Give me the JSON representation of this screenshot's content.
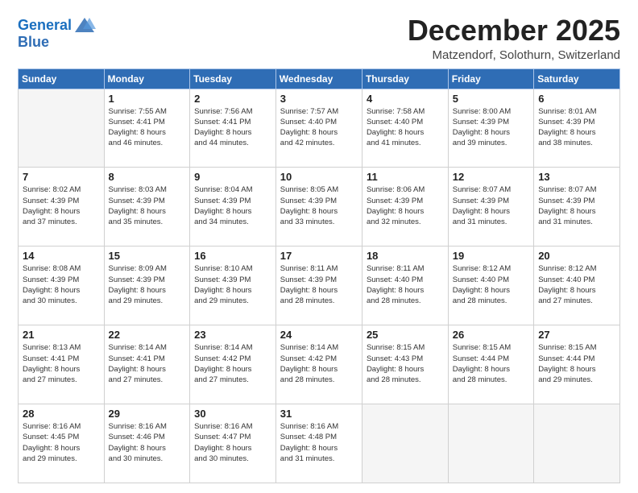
{
  "logo": {
    "line1": "General",
    "line2": "Blue"
  },
  "title": "December 2025",
  "location": "Matzendorf, Solothurn, Switzerland",
  "headers": [
    "Sunday",
    "Monday",
    "Tuesday",
    "Wednesday",
    "Thursday",
    "Friday",
    "Saturday"
  ],
  "weeks": [
    [
      {
        "day": "",
        "info": ""
      },
      {
        "day": "1",
        "info": "Sunrise: 7:55 AM\nSunset: 4:41 PM\nDaylight: 8 hours\nand 46 minutes."
      },
      {
        "day": "2",
        "info": "Sunrise: 7:56 AM\nSunset: 4:41 PM\nDaylight: 8 hours\nand 44 minutes."
      },
      {
        "day": "3",
        "info": "Sunrise: 7:57 AM\nSunset: 4:40 PM\nDaylight: 8 hours\nand 42 minutes."
      },
      {
        "day": "4",
        "info": "Sunrise: 7:58 AM\nSunset: 4:40 PM\nDaylight: 8 hours\nand 41 minutes."
      },
      {
        "day": "5",
        "info": "Sunrise: 8:00 AM\nSunset: 4:39 PM\nDaylight: 8 hours\nand 39 minutes."
      },
      {
        "day": "6",
        "info": "Sunrise: 8:01 AM\nSunset: 4:39 PM\nDaylight: 8 hours\nand 38 minutes."
      }
    ],
    [
      {
        "day": "7",
        "info": "Sunrise: 8:02 AM\nSunset: 4:39 PM\nDaylight: 8 hours\nand 37 minutes."
      },
      {
        "day": "8",
        "info": "Sunrise: 8:03 AM\nSunset: 4:39 PM\nDaylight: 8 hours\nand 35 minutes."
      },
      {
        "day": "9",
        "info": "Sunrise: 8:04 AM\nSunset: 4:39 PM\nDaylight: 8 hours\nand 34 minutes."
      },
      {
        "day": "10",
        "info": "Sunrise: 8:05 AM\nSunset: 4:39 PM\nDaylight: 8 hours\nand 33 minutes."
      },
      {
        "day": "11",
        "info": "Sunrise: 8:06 AM\nSunset: 4:39 PM\nDaylight: 8 hours\nand 32 minutes."
      },
      {
        "day": "12",
        "info": "Sunrise: 8:07 AM\nSunset: 4:39 PM\nDaylight: 8 hours\nand 31 minutes."
      },
      {
        "day": "13",
        "info": "Sunrise: 8:07 AM\nSunset: 4:39 PM\nDaylight: 8 hours\nand 31 minutes."
      }
    ],
    [
      {
        "day": "14",
        "info": "Sunrise: 8:08 AM\nSunset: 4:39 PM\nDaylight: 8 hours\nand 30 minutes."
      },
      {
        "day": "15",
        "info": "Sunrise: 8:09 AM\nSunset: 4:39 PM\nDaylight: 8 hours\nand 29 minutes."
      },
      {
        "day": "16",
        "info": "Sunrise: 8:10 AM\nSunset: 4:39 PM\nDaylight: 8 hours\nand 29 minutes."
      },
      {
        "day": "17",
        "info": "Sunrise: 8:11 AM\nSunset: 4:39 PM\nDaylight: 8 hours\nand 28 minutes."
      },
      {
        "day": "18",
        "info": "Sunrise: 8:11 AM\nSunset: 4:40 PM\nDaylight: 8 hours\nand 28 minutes."
      },
      {
        "day": "19",
        "info": "Sunrise: 8:12 AM\nSunset: 4:40 PM\nDaylight: 8 hours\nand 28 minutes."
      },
      {
        "day": "20",
        "info": "Sunrise: 8:12 AM\nSunset: 4:40 PM\nDaylight: 8 hours\nand 27 minutes."
      }
    ],
    [
      {
        "day": "21",
        "info": "Sunrise: 8:13 AM\nSunset: 4:41 PM\nDaylight: 8 hours\nand 27 minutes."
      },
      {
        "day": "22",
        "info": "Sunrise: 8:14 AM\nSunset: 4:41 PM\nDaylight: 8 hours\nand 27 minutes."
      },
      {
        "day": "23",
        "info": "Sunrise: 8:14 AM\nSunset: 4:42 PM\nDaylight: 8 hours\nand 27 minutes."
      },
      {
        "day": "24",
        "info": "Sunrise: 8:14 AM\nSunset: 4:42 PM\nDaylight: 8 hours\nand 28 minutes."
      },
      {
        "day": "25",
        "info": "Sunrise: 8:15 AM\nSunset: 4:43 PM\nDaylight: 8 hours\nand 28 minutes."
      },
      {
        "day": "26",
        "info": "Sunrise: 8:15 AM\nSunset: 4:44 PM\nDaylight: 8 hours\nand 28 minutes."
      },
      {
        "day": "27",
        "info": "Sunrise: 8:15 AM\nSunset: 4:44 PM\nDaylight: 8 hours\nand 29 minutes."
      }
    ],
    [
      {
        "day": "28",
        "info": "Sunrise: 8:16 AM\nSunset: 4:45 PM\nDaylight: 8 hours\nand 29 minutes."
      },
      {
        "day": "29",
        "info": "Sunrise: 8:16 AM\nSunset: 4:46 PM\nDaylight: 8 hours\nand 30 minutes."
      },
      {
        "day": "30",
        "info": "Sunrise: 8:16 AM\nSunset: 4:47 PM\nDaylight: 8 hours\nand 30 minutes."
      },
      {
        "day": "31",
        "info": "Sunrise: 8:16 AM\nSunset: 4:48 PM\nDaylight: 8 hours\nand 31 minutes."
      },
      {
        "day": "",
        "info": ""
      },
      {
        "day": "",
        "info": ""
      },
      {
        "day": "",
        "info": ""
      }
    ]
  ]
}
